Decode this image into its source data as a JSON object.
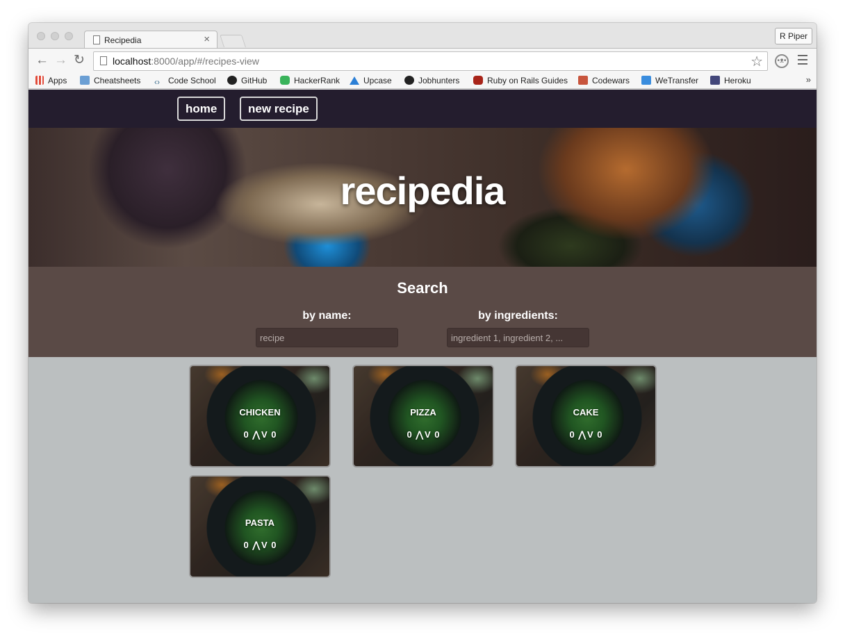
{
  "browser": {
    "tab_title": "Recipedia",
    "tab_close": "×",
    "profile_name": "R Piper",
    "url_host": "localhost",
    "url_rest": ":8000/app/#/recipes-view",
    "back_glyph": "←",
    "forward_glyph": "→",
    "reload_glyph": "↻",
    "star_glyph": "☆",
    "bookmarks": [
      {
        "label": "Apps",
        "icon": "apps-grid-icon",
        "color": "#e04b3a"
      },
      {
        "label": "Cheatsheets",
        "icon": "folder-icon",
        "color": "#6b9fd4"
      },
      {
        "label": "Code School",
        "icon": "code-brackets-icon",
        "color": "#3f6f8f"
      },
      {
        "label": "GitHub",
        "icon": "github-icon",
        "color": "#222222"
      },
      {
        "label": "HackerRank",
        "icon": "hackerrank-icon",
        "color": "#39b35a"
      },
      {
        "label": "Upcase",
        "icon": "upcase-icon",
        "color": "#2b7fd6"
      },
      {
        "label": "Jobhunters",
        "icon": "github-icon",
        "color": "#222222"
      },
      {
        "label": "Ruby on Rails Guides",
        "icon": "rails-icon",
        "color": "#a82419"
      },
      {
        "label": "Codewars",
        "icon": "codewars-icon",
        "color": "#c8553d"
      },
      {
        "label": "WeTransfer",
        "icon": "wetransfer-icon",
        "color": "#3a8dde"
      },
      {
        "label": "Heroku",
        "icon": "heroku-icon",
        "color": "#43477a"
      }
    ],
    "bookmarks_more": "»"
  },
  "site": {
    "nav": {
      "home_label": "home",
      "new_recipe_label": "new recipe"
    },
    "hero_title": "recipedia",
    "search": {
      "title": "Search",
      "by_name_label": "by name:",
      "by_name_placeholder": "recipe",
      "by_ingredients_label": "by ingredients:",
      "by_ingredients_placeholder": "ingredient 1, ingredient 2, ..."
    },
    "recipes": [
      {
        "name": "CHICKEN",
        "upvotes": "0",
        "downvotes": "0"
      },
      {
        "name": "PIZZA",
        "upvotes": "0",
        "downvotes": "0"
      },
      {
        "name": "CAKE",
        "upvotes": "0",
        "downvotes": "0"
      },
      {
        "name": "PASTA",
        "upvotes": "0",
        "downvotes": "0"
      }
    ],
    "upvote_glyph": "⋀",
    "downvote_glyph": "V"
  },
  "colors": {
    "nav_bg": "#241d2e",
    "search_bg": "#5a4a46",
    "page_bg": "#bbbfc0"
  }
}
